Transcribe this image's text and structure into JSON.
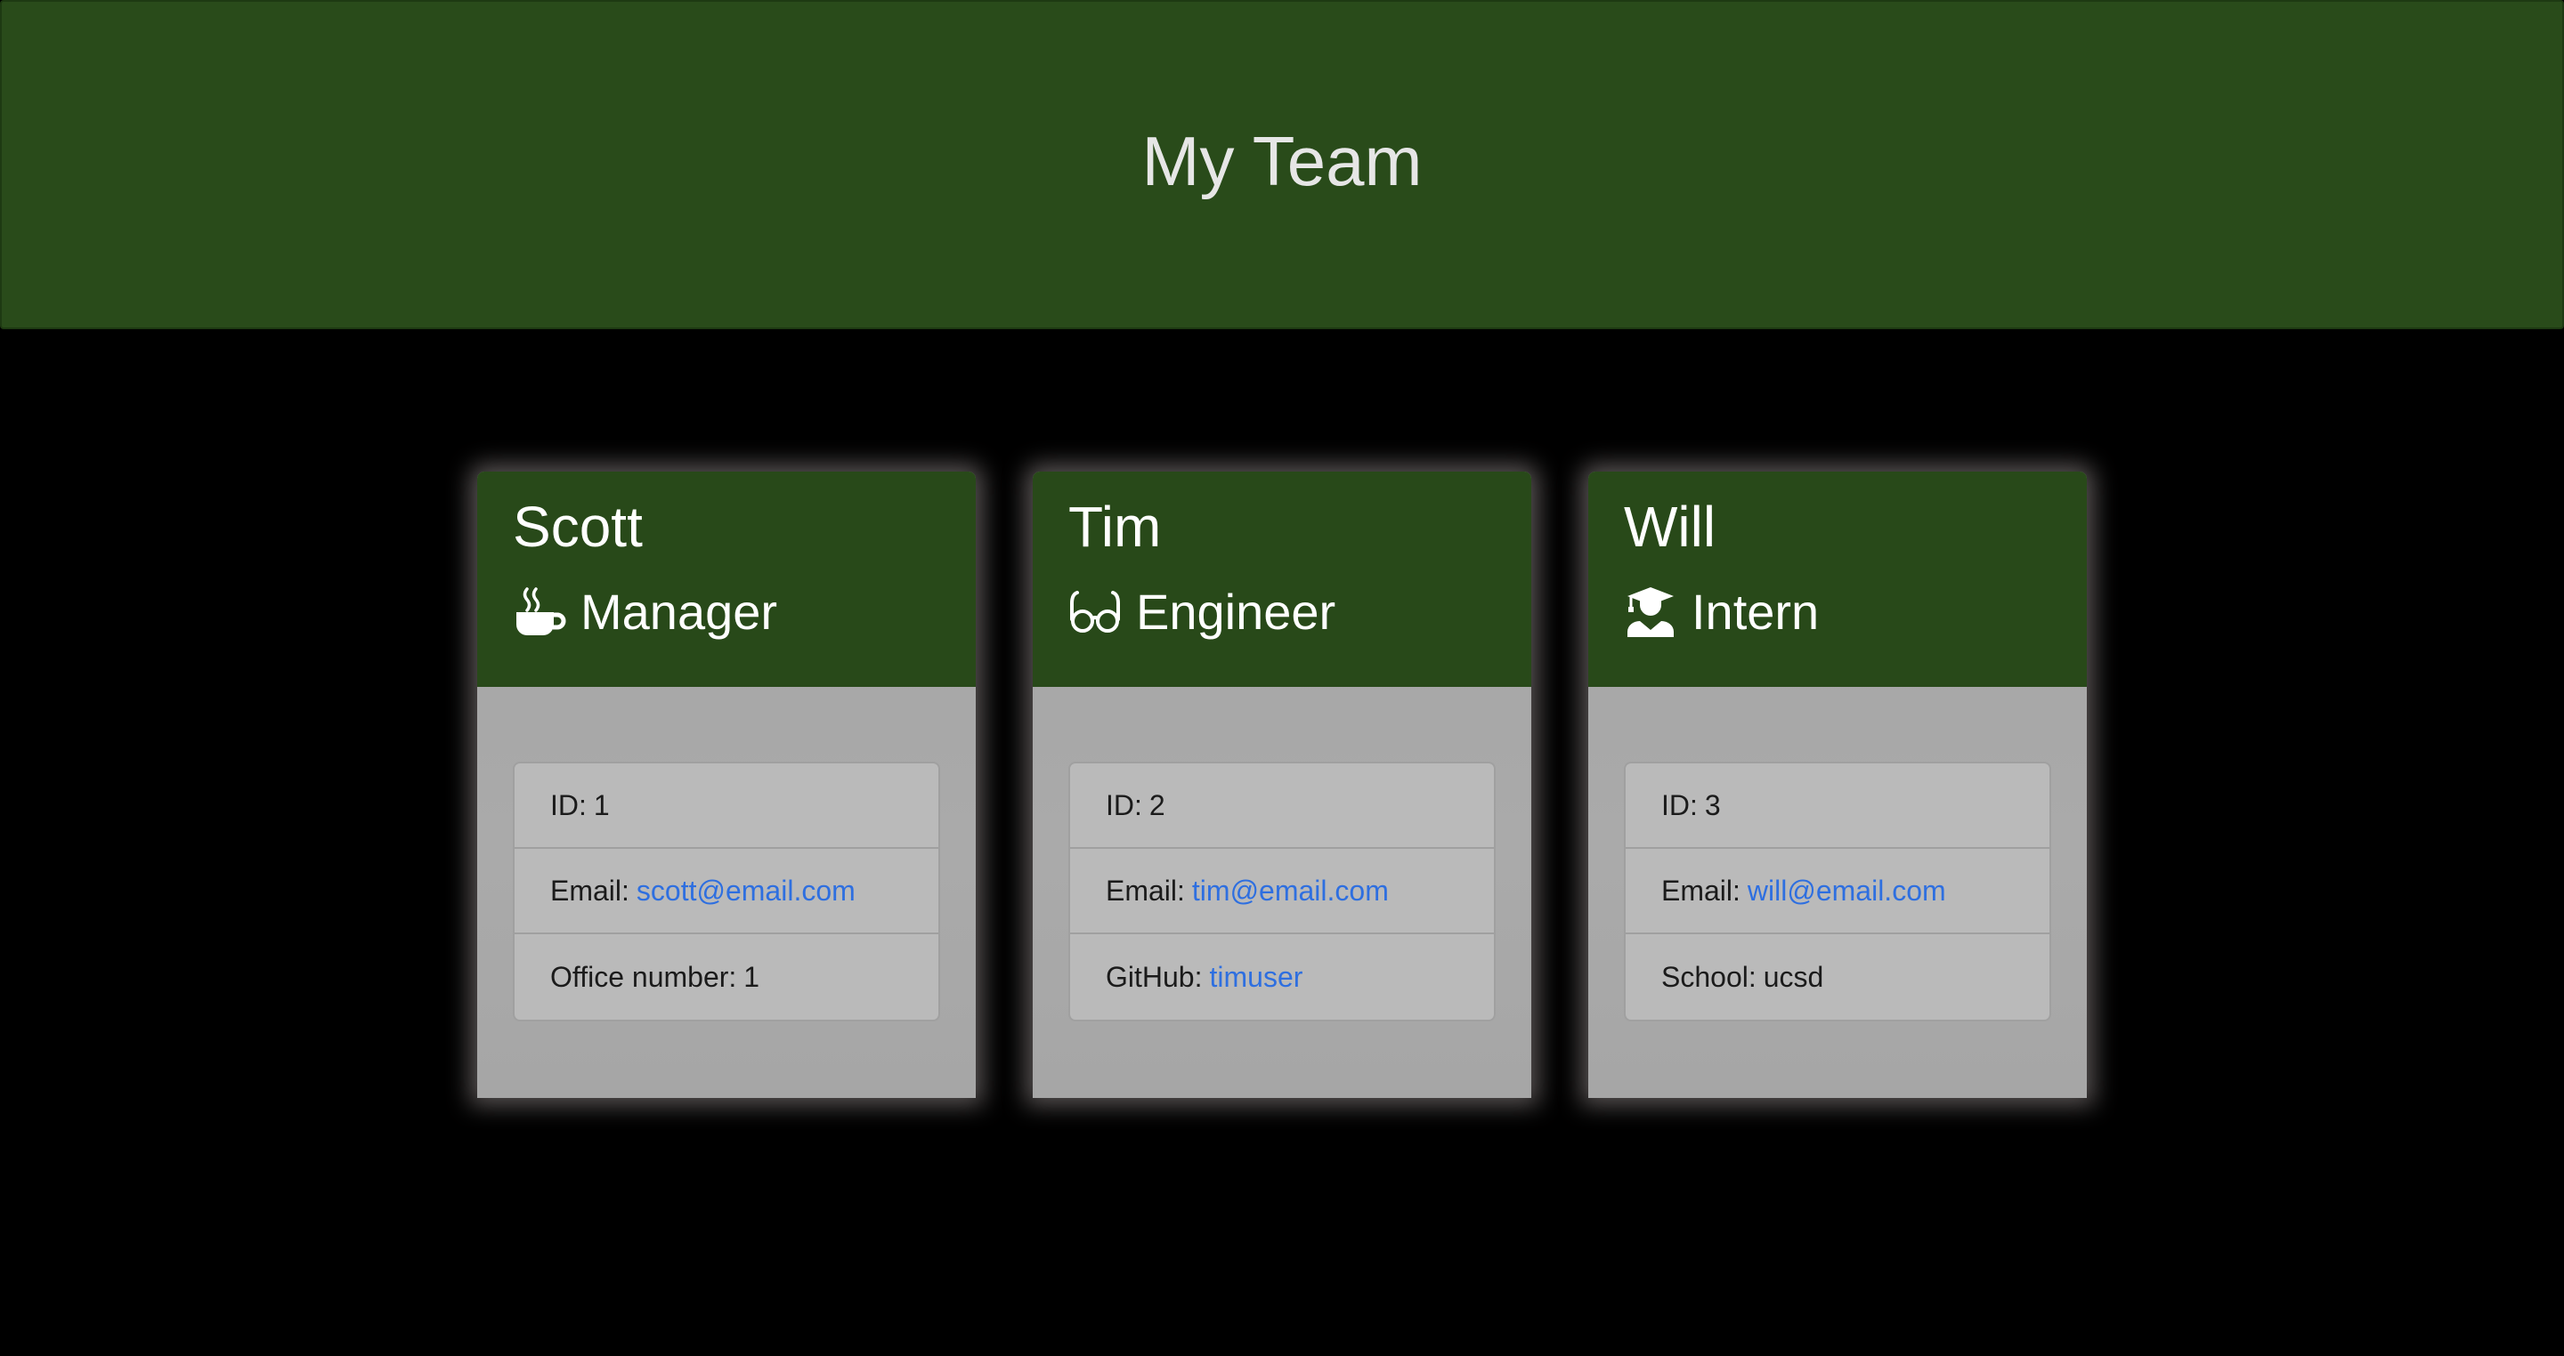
{
  "header": {
    "title": "My Team"
  },
  "team": [
    {
      "name": "Scott",
      "role": "Manager",
      "role_icon": "coffee-mug-icon",
      "id_label": "ID:",
      "id": "1",
      "email_label": "Email:",
      "email": "scott@email.com",
      "extra_label": "Office number:",
      "extra_value": "1",
      "extra_is_link": false
    },
    {
      "name": "Tim",
      "role": "Engineer",
      "role_icon": "glasses-icon",
      "id_label": "ID:",
      "id": "2",
      "email_label": "Email:",
      "email": "tim@email.com",
      "extra_label": "GitHub:",
      "extra_value": "timuser",
      "extra_is_link": true
    },
    {
      "name": "Will",
      "role": "Intern",
      "role_icon": "graduate-icon",
      "id_label": "ID:",
      "id": "3",
      "email_label": "Email:",
      "email": "will@email.com",
      "extra_label": "School:",
      "extra_value": "ucsd",
      "extra_is_link": false
    }
  ],
  "colors": {
    "header_bg": "#294b1a",
    "card_head_bg": "#284919",
    "link": "#2e6fe0",
    "page_bg": "#000000"
  }
}
